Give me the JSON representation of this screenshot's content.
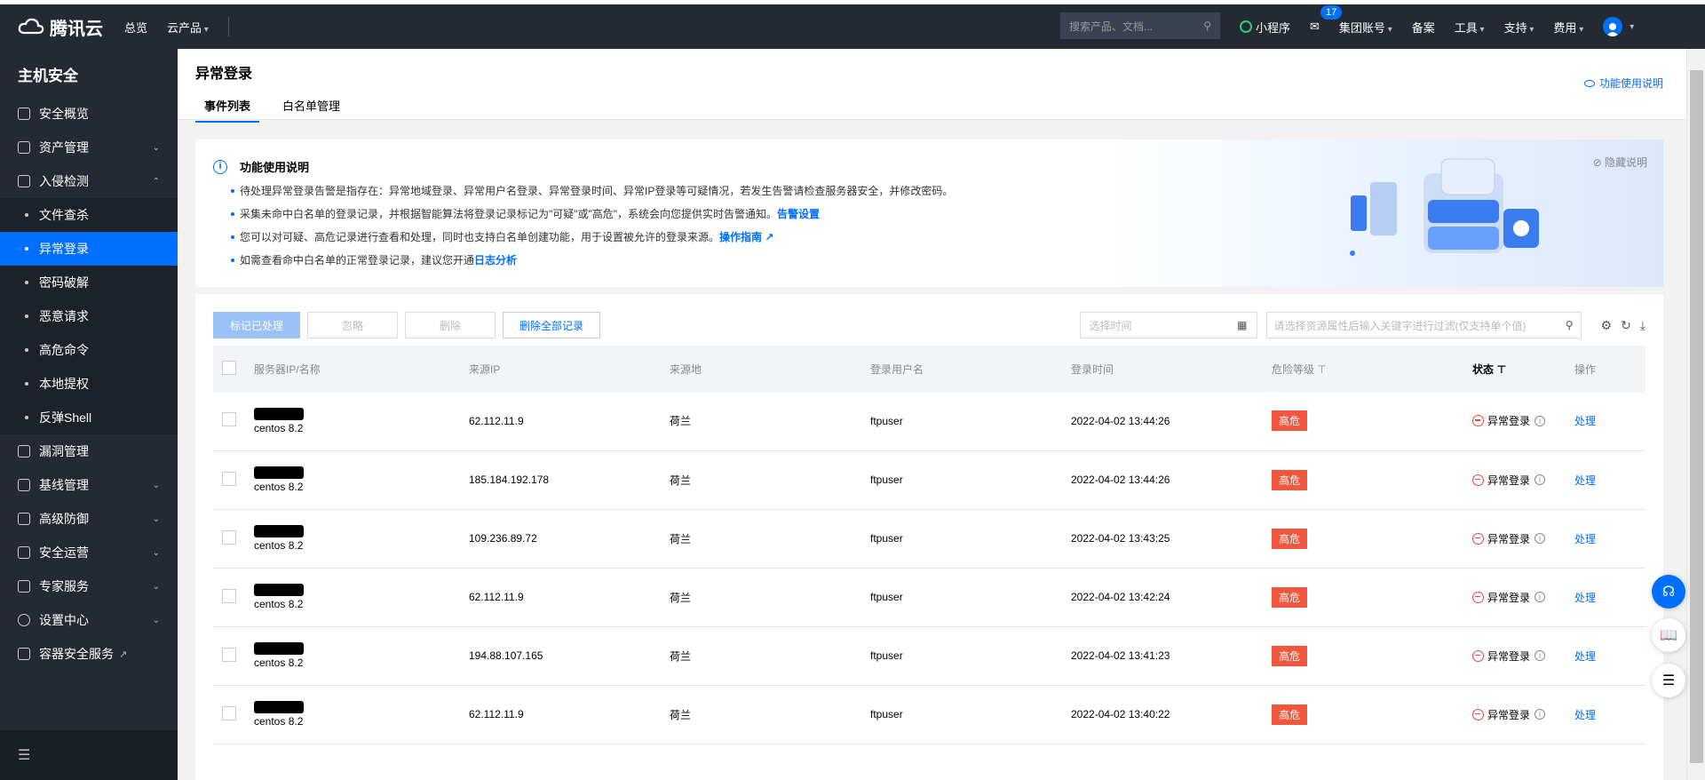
{
  "topbar": {
    "brand": "腾讯云",
    "nav": [
      "总览",
      "云产品"
    ],
    "search_placeholder": "搜索产品、文档...",
    "mini_program": "小程序",
    "mail_count": "17",
    "items": [
      "集团账号",
      "备案",
      "工具",
      "支持",
      "费用"
    ]
  },
  "sidebar": {
    "title": "主机安全",
    "items": [
      {
        "label": "安全概览"
      },
      {
        "label": "资产管理"
      },
      {
        "label": "入侵检测"
      }
    ],
    "subitems": [
      "文件查杀",
      "异常登录",
      "密码破解",
      "恶意请求",
      "高危命令",
      "本地提权",
      "反弹Shell"
    ],
    "items2": [
      "漏洞管理",
      "基线管理",
      "高级防御",
      "安全运营",
      "专家服务",
      "设置中心",
      "容器安全服务"
    ]
  },
  "header": {
    "title": "异常登录",
    "tabs": [
      "事件列表",
      "白名单管理"
    ],
    "help_link": "功能使用说明"
  },
  "info": {
    "title": "功能使用说明",
    "hide": "隐藏说明",
    "line1": "待处理异常登录告警是指存在：异常地域登录、异常用户名登录、异常登录时间、异常IP登录等可疑情况，若发生告警请检查服务器安全，并修改密码。",
    "line2": "采集未命中白名单的登录记录，并根据智能算法将登录记录标记为\"可疑\"或\"高危\"，系统会向您提供实时告警通知。",
    "line2_link": "告警设置",
    "line3": "您可以对可疑、高危记录进行查看和处理，同时也支持白名单创建功能，用于设置被允许的登录来源。",
    "line3_link": "操作指南",
    "line4": "如需查看命中白名单的正常登录记录，建议您开通",
    "line4_link": "日志分析"
  },
  "toolbar": {
    "mark": "标记已处理",
    "ignore": "忽略",
    "delete": "删除",
    "delete_all": "删除全部记录",
    "date_placeholder": "选择时间",
    "filter_placeholder": "请选择资源属性后输入关键字进行过滤(仅支持单个值)"
  },
  "table": {
    "headers": [
      "服务器IP/名称",
      "来源IP",
      "来源地",
      "登录用户名",
      "登录时间",
      "危险等级",
      "状态",
      "操作"
    ],
    "rows": [
      {
        "server": "centos 8.2",
        "ip": "62.112.11.9",
        "loc": "荷兰",
        "user": "ftpuser",
        "time": "2022-04-02 13:44:26",
        "level": "高危",
        "status": "异常登录",
        "action": "处理"
      },
      {
        "server": "centos 8.2",
        "ip": "185.184.192.178",
        "loc": "荷兰",
        "user": "ftpuser",
        "time": "2022-04-02 13:44:26",
        "level": "高危",
        "status": "异常登录",
        "action": "处理"
      },
      {
        "server": "centos 8.2",
        "ip": "109.236.89.72",
        "loc": "荷兰",
        "user": "ftpuser",
        "time": "2022-04-02 13:43:25",
        "level": "高危",
        "status": "异常登录",
        "action": "处理"
      },
      {
        "server": "centos 8.2",
        "ip": "62.112.11.9",
        "loc": "荷兰",
        "user": "ftpuser",
        "time": "2022-04-02 13:42:24",
        "level": "高危",
        "status": "异常登录",
        "action": "处理"
      },
      {
        "server": "centos 8.2",
        "ip": "194.88.107.165",
        "loc": "荷兰",
        "user": "ftpuser",
        "time": "2022-04-02 13:41:23",
        "level": "高危",
        "status": "异常登录",
        "action": "处理"
      },
      {
        "server": "centos 8.2",
        "ip": "62.112.11.9",
        "loc": "荷兰",
        "user": "ftpuser",
        "time": "2022-04-02 13:40:22",
        "level": "高危",
        "status": "异常登录",
        "action": "处理"
      }
    ]
  }
}
